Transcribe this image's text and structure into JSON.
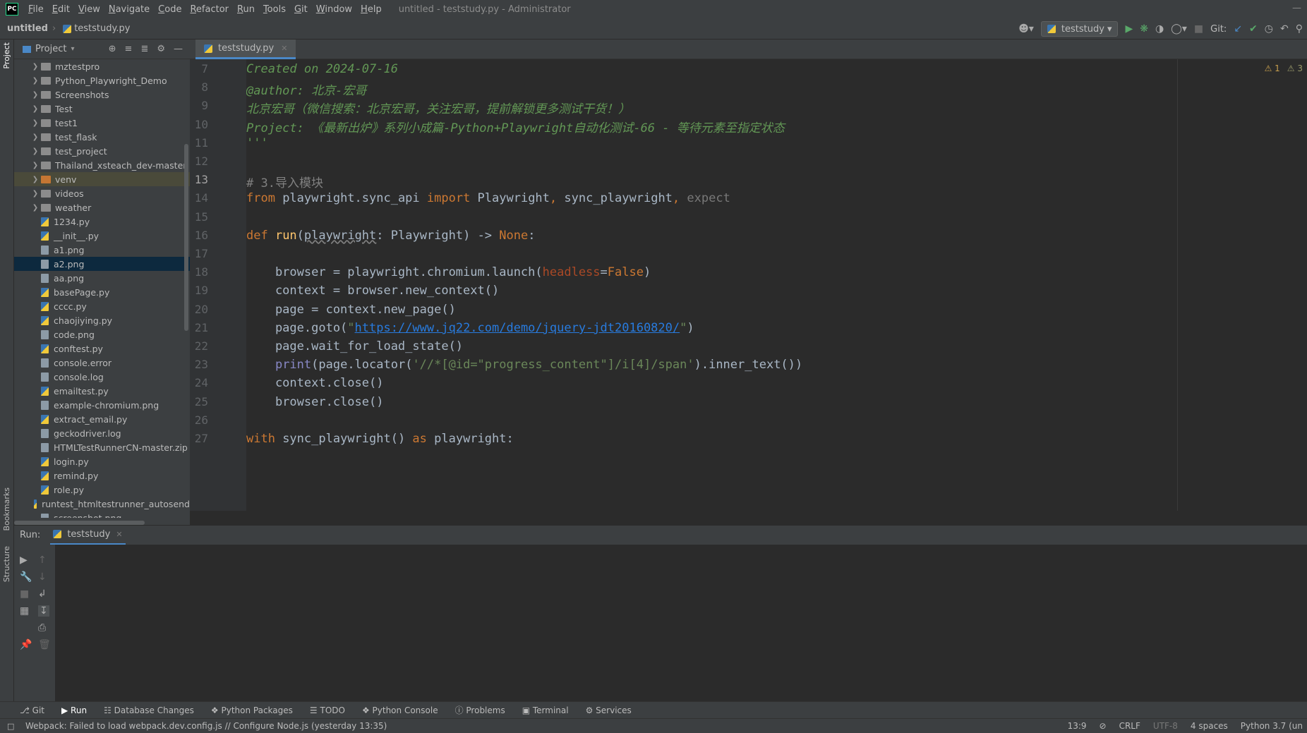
{
  "app": {
    "logo": "PC",
    "window_title": "untitled - teststudy.py - Administrator"
  },
  "menu": [
    "File",
    "Edit",
    "View",
    "Navigate",
    "Code",
    "Refactor",
    "Run",
    "Tools",
    "Git",
    "Window",
    "Help"
  ],
  "breadcrumb": {
    "project": "untitled",
    "file": "teststudy.py"
  },
  "toolbar": {
    "run_config": "teststudy",
    "git_label": "Git:"
  },
  "side_tabs": {
    "project": "Project",
    "bookmarks": "Bookmarks",
    "structure": "Structure"
  },
  "project_panel": {
    "title": "Project",
    "items": [
      {
        "name": "mztestpro",
        "type": "folder"
      },
      {
        "name": "Python_Playwright_Demo",
        "type": "folder"
      },
      {
        "name": "Screenshots",
        "type": "folder"
      },
      {
        "name": "Test",
        "type": "folder"
      },
      {
        "name": "test1",
        "type": "folder"
      },
      {
        "name": "test_flask",
        "type": "folder"
      },
      {
        "name": "test_project",
        "type": "folder"
      },
      {
        "name": "Thailand_xsteach_dev-master",
        "type": "folder"
      },
      {
        "name": "venv",
        "type": "venv"
      },
      {
        "name": "videos",
        "type": "folder"
      },
      {
        "name": "weather",
        "type": "folder"
      },
      {
        "name": "1234.py",
        "type": "py"
      },
      {
        "name": "__init__.py",
        "type": "py"
      },
      {
        "name": "a1.png",
        "type": "file"
      },
      {
        "name": "a2.png",
        "type": "file",
        "selected": true
      },
      {
        "name": "aa.png",
        "type": "file"
      },
      {
        "name": "basePage.py",
        "type": "py"
      },
      {
        "name": "cccc.py",
        "type": "py"
      },
      {
        "name": "chaojiying.py",
        "type": "py"
      },
      {
        "name": "code.png",
        "type": "file"
      },
      {
        "name": "conftest.py",
        "type": "py"
      },
      {
        "name": "console.error",
        "type": "file"
      },
      {
        "name": "console.log",
        "type": "file"
      },
      {
        "name": "emailtest.py",
        "type": "py"
      },
      {
        "name": "example-chromium.png",
        "type": "file"
      },
      {
        "name": "extract_email.py",
        "type": "py"
      },
      {
        "name": "geckodriver.log",
        "type": "file"
      },
      {
        "name": "HTMLTestRunnerCN-master.zip",
        "type": "file"
      },
      {
        "name": "login.py",
        "type": "py"
      },
      {
        "name": "remind.py",
        "type": "py"
      },
      {
        "name": "role.py",
        "type": "py"
      },
      {
        "name": "runtest_htmltestrunner_autosend",
        "type": "py"
      },
      {
        "name": "screenshot.png",
        "type": "file"
      }
    ]
  },
  "editor": {
    "tab": "teststudy.py",
    "warnings": [
      "1",
      "3"
    ],
    "current_line": "13",
    "lines": [
      {
        "no": "7",
        "parts": [
          {
            "t": "Created on 2024-07-16",
            "c": "c-doc"
          }
        ]
      },
      {
        "no": "8",
        "parts": [
          {
            "t": "@author: 北京-宏哥",
            "c": "c-doc"
          }
        ]
      },
      {
        "no": "9",
        "parts": [
          {
            "t": "北京宏哥（微信搜索：北京宏哥，关注宏哥，提前解锁更多测试干货！）",
            "c": "c-doc"
          }
        ]
      },
      {
        "no": "10",
        "parts": [
          {
            "t": "Project: 《最新出炉》系列小成篇-Python+Playwright自动化测试-66 - 等待元素至指定状态",
            "c": "c-doc"
          }
        ]
      },
      {
        "no": "11",
        "parts": [
          {
            "t": "'''",
            "c": "c-doc"
          }
        ]
      },
      {
        "no": "12",
        "parts": []
      },
      {
        "no": "13",
        "parts": [
          {
            "t": "# 3.导入模块",
            "c": "c-cmt"
          }
        ]
      },
      {
        "no": "14",
        "parts": [
          {
            "t": "from ",
            "c": "c-kw"
          },
          {
            "t": "playwright.sync_api ",
            "c": ""
          },
          {
            "t": "import ",
            "c": "c-kw"
          },
          {
            "t": "Playwright",
            "c": ""
          },
          {
            "t": ", ",
            "c": "c-kw"
          },
          {
            "t": "sync_playwright",
            "c": ""
          },
          {
            "t": ", ",
            "c": "c-kw"
          },
          {
            "t": "expect",
            "c": "c-dim"
          }
        ]
      },
      {
        "no": "15",
        "parts": []
      },
      {
        "no": "16",
        "parts": [
          {
            "t": "def ",
            "c": "c-kw"
          },
          {
            "t": "run",
            "c": "c-fn"
          },
          {
            "t": "(",
            "c": ""
          },
          {
            "t": "playwright",
            "c": "c-under"
          },
          {
            "t": ": Playwright) -> ",
            "c": ""
          },
          {
            "t": "None",
            "c": "c-kw"
          },
          {
            "t": ":",
            "c": ""
          }
        ]
      },
      {
        "no": "17",
        "parts": []
      },
      {
        "no": "18",
        "parts": [
          {
            "t": "    browser = playwright.chromium.launch(",
            "c": ""
          },
          {
            "t": "headless",
            "c": "c-param"
          },
          {
            "t": "=",
            "c": ""
          },
          {
            "t": "False",
            "c": "c-kw"
          },
          {
            "t": ")",
            "c": ""
          }
        ]
      },
      {
        "no": "19",
        "parts": [
          {
            "t": "    context = browser.new_context()",
            "c": ""
          }
        ]
      },
      {
        "no": "20",
        "parts": [
          {
            "t": "    page = context.new_page()",
            "c": ""
          }
        ]
      },
      {
        "no": "21",
        "parts": [
          {
            "t": "    page.goto(",
            "c": ""
          },
          {
            "t": "\"",
            "c": "c-str"
          },
          {
            "t": "https://www.jq22.com/demo/jquery-jdt20160820/",
            "c": "c-link"
          },
          {
            "t": "\"",
            "c": "c-str"
          },
          {
            "t": ")",
            "c": ""
          }
        ]
      },
      {
        "no": "22",
        "parts": [
          {
            "t": "    page.wait_for_load_state()",
            "c": ""
          }
        ]
      },
      {
        "no": "23",
        "parts": [
          {
            "t": "    ",
            "c": ""
          },
          {
            "t": "print",
            "c": "c-builtin"
          },
          {
            "t": "(page.locator(",
            "c": ""
          },
          {
            "t": "'//*[@id=\"progress_content\"]/i[4]/span'",
            "c": "c-str"
          },
          {
            "t": ").inner_text())",
            "c": ""
          }
        ]
      },
      {
        "no": "24",
        "parts": [
          {
            "t": "    context.close()",
            "c": ""
          }
        ]
      },
      {
        "no": "25",
        "parts": [
          {
            "t": "    browser.close()",
            "c": ""
          }
        ]
      },
      {
        "no": "26",
        "parts": []
      },
      {
        "no": "27",
        "parts": [
          {
            "t": "with ",
            "c": "c-kw"
          },
          {
            "t": "sync_playwright() ",
            "c": ""
          },
          {
            "t": "as ",
            "c": "c-kw"
          },
          {
            "t": "playwright:",
            "c": ""
          }
        ]
      }
    ]
  },
  "run_panel": {
    "label": "Run:",
    "tab": "teststudy"
  },
  "tool_windows": [
    "Git",
    "Run",
    "Database Changes",
    "Python Packages",
    "TODO",
    "Python Console",
    "Problems",
    "Terminal",
    "Services"
  ],
  "status": {
    "message": "Webpack: Failed to load webpack.dev.config.js // Configure Node.js (yesterday 13:35)",
    "position": "13:9",
    "line_sep": "CRLF",
    "encoding": "UTF-8",
    "indent": "4 spaces",
    "interpreter": "Python 3.7 (un"
  },
  "colors": {
    "accent": "#4a88c7",
    "selection": "#0d293e",
    "venv": "#c57633"
  }
}
